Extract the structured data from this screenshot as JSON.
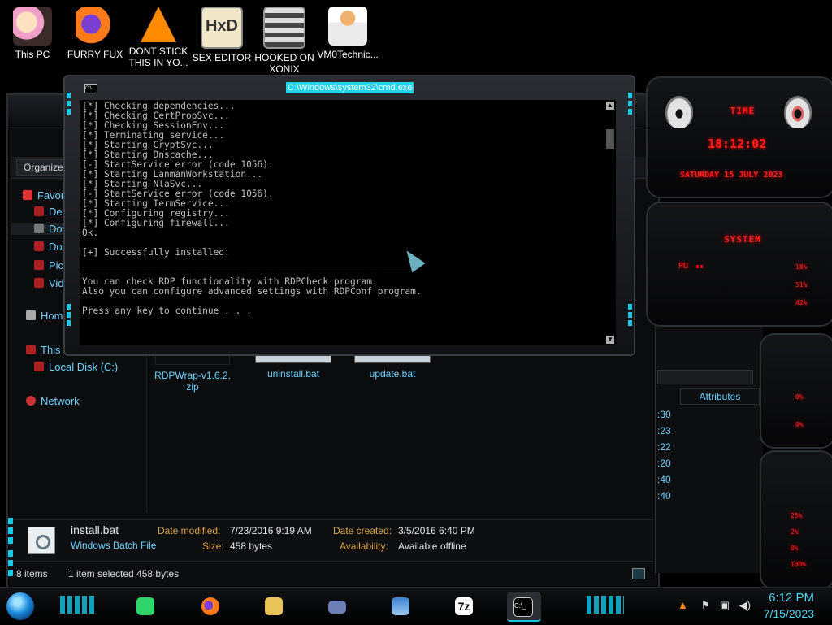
{
  "desktop": {
    "icons": [
      {
        "label": "This PC"
      },
      {
        "label": "FURRY FUX"
      },
      {
        "label": "DONT STICK THIS IN YO..."
      },
      {
        "label": "SEX EDITOR"
      },
      {
        "label": "HOOKED ON XONIX"
      },
      {
        "label": "VM0Technic..."
      }
    ]
  },
  "explorer": {
    "organize_label": "Organize",
    "sidebar": [
      {
        "label": "Favor"
      },
      {
        "label": "Des"
      },
      {
        "label": "Dow"
      },
      {
        "label": "Doc"
      },
      {
        "label": "Pict"
      },
      {
        "label": "Vid"
      },
      {
        "label": "Hom"
      },
      {
        "label": "This P"
      },
      {
        "label": "Local Disk (C:)"
      },
      {
        "label": "Network"
      }
    ],
    "files": [
      {
        "name": "RDPWrap-v1.6.2.zip"
      },
      {
        "name": "uninstall.bat"
      },
      {
        "name": "update.bat"
      }
    ],
    "details": {
      "file_name": "install.bat",
      "file_type": "Windows Batch File",
      "date_modified_label": "Date modified:",
      "date_modified": "7/23/2016 9:19 AM",
      "size_label": "Size:",
      "size": "458 bytes",
      "date_created_label": "Date created:",
      "date_created": "3/5/2016 6:40 PM",
      "availability_label": "Availability:",
      "availability": "Available offline"
    },
    "status": {
      "items": "8 items",
      "selection": "1 item selected  458 bytes"
    }
  },
  "props_panel": {
    "header": "Attributes",
    "times": [
      ":30",
      ":23",
      ":22",
      ":20",
      ":40",
      ":40"
    ]
  },
  "gadgets": {
    "clock_title": "TIME",
    "clock_time": "18:12:02",
    "clock_date": "SATURDAY 15 JULY 2023",
    "system_title": "SYSTEM",
    "system_label": "PU",
    "stats_a": [
      "18%",
      "51%",
      "42%"
    ],
    "stats_b": [
      "0%",
      "0%"
    ],
    "stats_c": [
      "25%",
      "2%",
      "0%",
      "100%"
    ]
  },
  "cmd": {
    "title": "C:\\Windows\\system32\\cmd.exe",
    "lines": [
      "[*] Checking dependencies...",
      "[*] Checking CertPropSvc...",
      "[*] Checking SessionEnv...",
      "[*] Terminating service...",
      "[*] Starting CryptSvc...",
      "[*] Starting Dnscache...",
      "[-] StartService error (code 1056).",
      "[*] Starting LanmanWorkstation...",
      "[*] Starting NlaSvc...",
      "[-] StartService error (code 1056).",
      "[*] Starting TermService...",
      "[*] Configuring registry...",
      "[*] Configuring firewall...",
      "Ok.",
      "",
      "[+] Successfully installed.",
      "______________________________________________________________",
      "",
      "You can check RDP functionality with RDPCheck program.",
      "Also you can configure advanced settings with RDPConf program.",
      "",
      "Press any key to continue . . ."
    ]
  },
  "taskbar": {
    "time": "6:12 PM",
    "date": "7/15/2023",
    "apps": [
      "notepad",
      "firefox",
      "file-explorer",
      "control-panel",
      "remote-desktop",
      "7zip",
      "cmd"
    ],
    "seven_zip_label": "7z",
    "cmd_label": "C:\\_"
  }
}
